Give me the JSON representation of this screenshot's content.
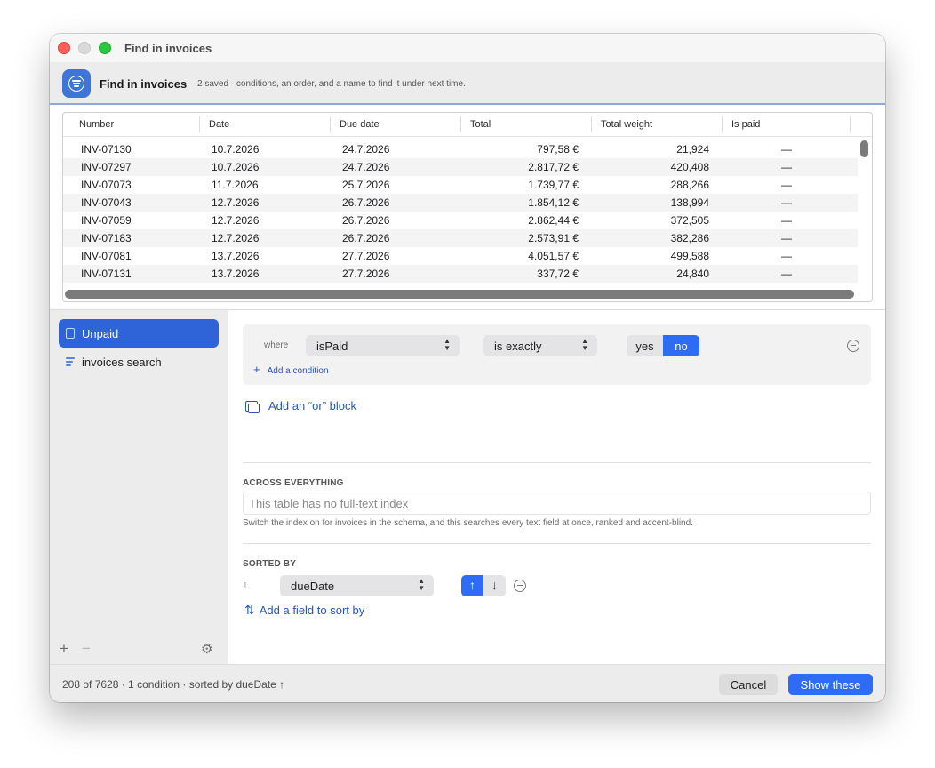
{
  "window": {
    "title": "Find in invoices"
  },
  "header": {
    "title": "Find in invoices",
    "subtitle": "2 saved · conditions, an order, and a name to find it under next time."
  },
  "table": {
    "columns": [
      "Number",
      "Date",
      "Due date",
      "Total",
      "Total weight",
      "Is paid"
    ],
    "rows": [
      [
        "INV-07130",
        "10.7.2026",
        "24.7.2026",
        "797,58 €",
        "21,924",
        "—"
      ],
      [
        "INV-07297",
        "10.7.2026",
        "24.7.2026",
        "2.817,72 €",
        "420,408",
        "—"
      ],
      [
        "INV-07073",
        "11.7.2026",
        "25.7.2026",
        "1.739,77 €",
        "288,266",
        "—"
      ],
      [
        "INV-07043",
        "12.7.2026",
        "26.7.2026",
        "1.854,12 €",
        "138,994",
        "—"
      ],
      [
        "INV-07059",
        "12.7.2026",
        "26.7.2026",
        "2.862,44 €",
        "372,505",
        "—"
      ],
      [
        "INV-07183",
        "12.7.2026",
        "26.7.2026",
        "2.573,91 €",
        "382,286",
        "—"
      ],
      [
        "INV-07081",
        "13.7.2026",
        "27.7.2026",
        "4.051,57 €",
        "499,588",
        "—"
      ],
      [
        "INV-07131",
        "13.7.2026",
        "27.7.2026",
        "337,72 €",
        "24,840",
        "—"
      ]
    ]
  },
  "sidebar": {
    "items": [
      {
        "label": "Unpaid",
        "icon": "document-icon",
        "selected": true
      },
      {
        "label": "invoices search",
        "icon": "lines-icon",
        "selected": false
      }
    ],
    "add": "+",
    "remove": "−",
    "settings": "⚙"
  },
  "condition": {
    "where": "where",
    "field": "isPaid",
    "operator": "is exactly",
    "yes": "yes",
    "no": "no",
    "selected_value": "no",
    "add_condition": "Add a condition"
  },
  "or_block": {
    "label": "Add an “or” block"
  },
  "fulltext": {
    "heading": "ACROSS EVERYTHING",
    "placeholder": "This table has no full-text index",
    "help": "Switch the index on for invoices in the schema, and this searches every text field at once, ranked and accent-blind."
  },
  "sort": {
    "heading": "SORTED BY",
    "index": "1.",
    "field": "dueDate",
    "direction": "ascending",
    "up": "↑",
    "down": "↓",
    "add": "Add a field to sort by",
    "add_icon": "⇅"
  },
  "footer": {
    "status": "208 of 7628 · 1 condition · sorted by dueDate ↑",
    "cancel": "Cancel",
    "confirm": "Show these"
  },
  "colors": {
    "accent": "#2f6cf6",
    "sidebar_selected": "#2f63d8",
    "link": "#2756b8"
  }
}
